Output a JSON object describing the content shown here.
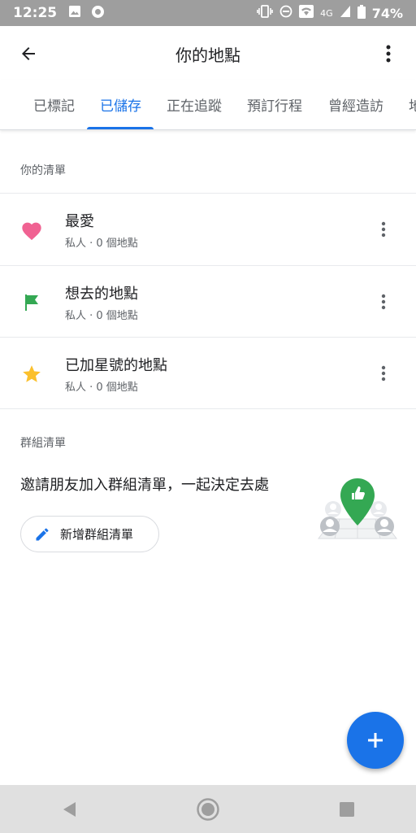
{
  "status_bar": {
    "time": "12:25",
    "network": "4G",
    "battery": "74%"
  },
  "header": {
    "title": "你的地點"
  },
  "tabs": [
    {
      "label": "已標記",
      "active": false
    },
    {
      "label": "已儲存",
      "active": true
    },
    {
      "label": "正在追蹤",
      "active": false
    },
    {
      "label": "預訂行程",
      "active": false
    },
    {
      "label": "曾經造訪",
      "active": false
    },
    {
      "label": "地",
      "active": false
    }
  ],
  "your_lists": {
    "header": "你的清單",
    "items": [
      {
        "title": "最愛",
        "subtitle": "私人 · 0 個地點",
        "icon": "heart-icon",
        "color": "#f06292"
      },
      {
        "title": "想去的地點",
        "subtitle": "私人 · 0 個地點",
        "icon": "flag-icon",
        "color": "#34a853"
      },
      {
        "title": "已加星號的地點",
        "subtitle": "私人 · 0 個地點",
        "icon": "star-icon",
        "color": "#fbc02d"
      }
    ]
  },
  "group_lists": {
    "header": "群組清單",
    "promo": "邀請朋友加入群組清單，一起決定去處",
    "new_button_label": "新增群組清單"
  },
  "colors": {
    "accent": "#1a73e8",
    "status_bar": "#9e9e9e",
    "nav_bar": "#e0e0e0"
  }
}
